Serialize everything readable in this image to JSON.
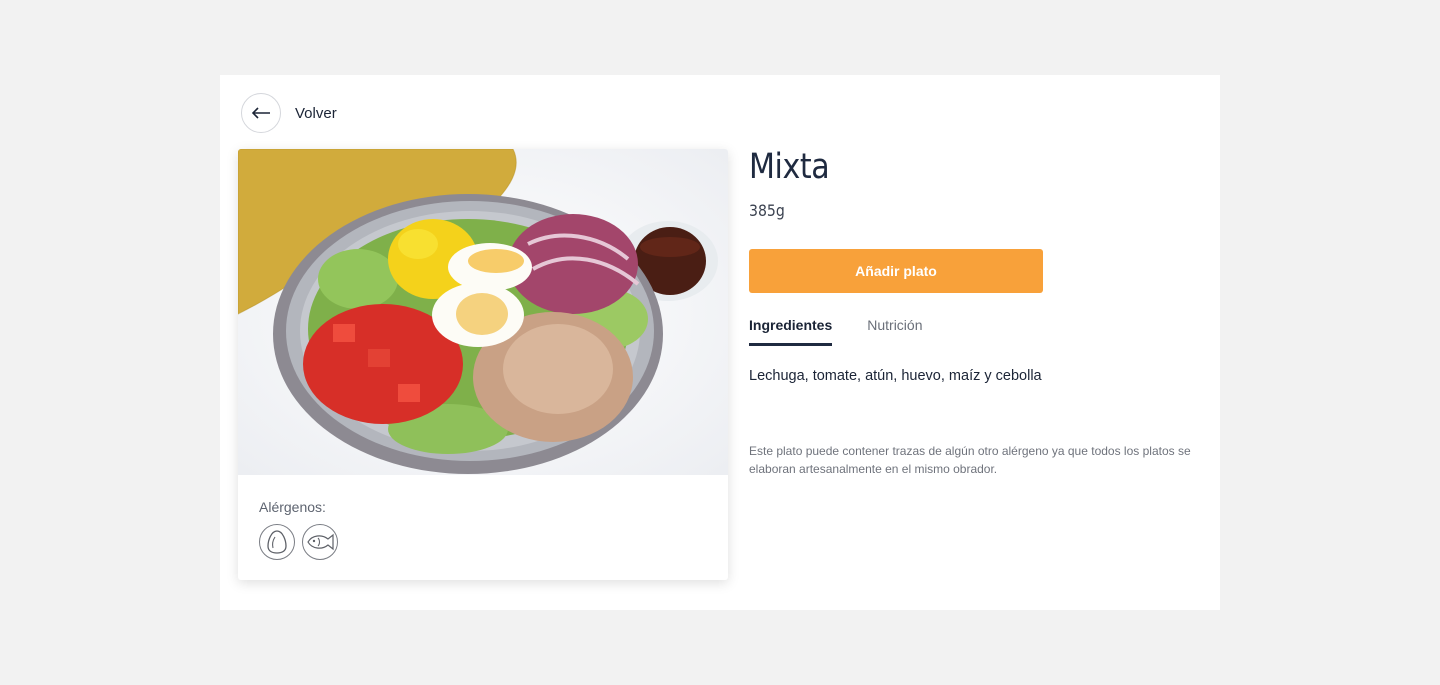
{
  "navigation": {
    "back_label": "Volver",
    "back_icon": "arrow-left-icon"
  },
  "dish": {
    "name": "Mixta",
    "weight": "385g",
    "add_button_label": "Añadir plato",
    "tabs": [
      {
        "label": "Ingredientes",
        "active": true
      },
      {
        "label": "Nutrición",
        "active": false
      }
    ],
    "ingredients": "Lechuga, tomate, atún, huevo, maíz y cebolla",
    "disclaimer": "Este plato puede contener trazas de algún otro alérgeno ya que todos los platos se elaboran artesanalmente en el mismo obrador."
  },
  "allergens": {
    "title": "Alérgenos:",
    "icons": [
      "egg-icon",
      "fish-icon"
    ]
  },
  "colors": {
    "accent": "#f8a13a",
    "text_dark": "#1f2a40",
    "background": "#f2f2f2"
  }
}
